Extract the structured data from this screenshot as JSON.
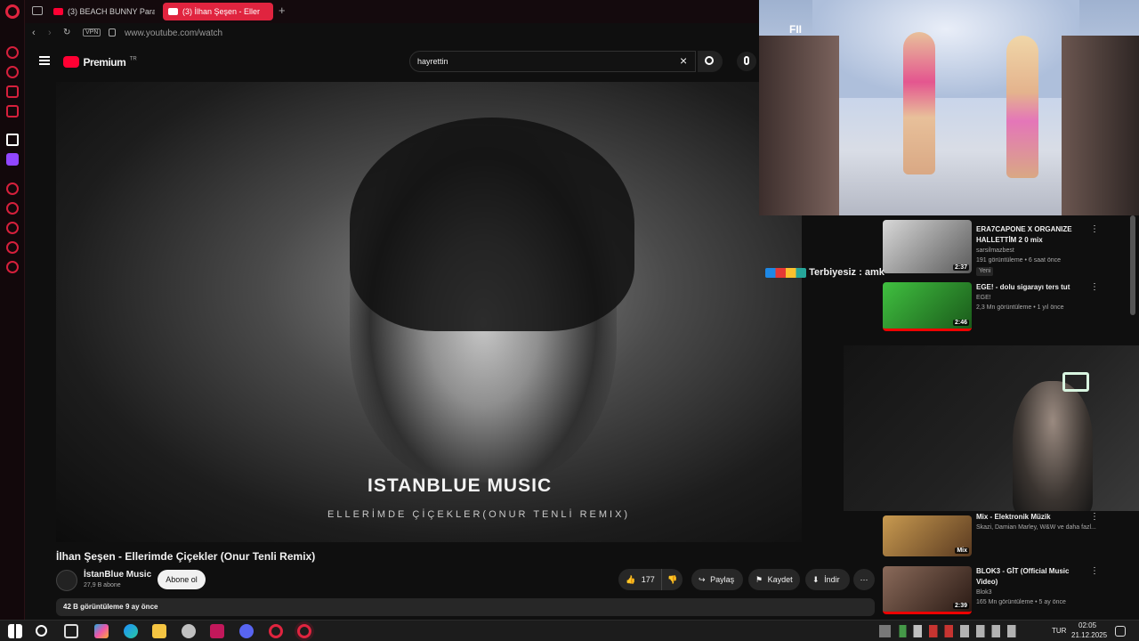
{
  "tabs": [
    {
      "label": "(3) BEACH BUNNY Paradi"
    },
    {
      "label": "(3) İlhan Şeşen - Eller"
    }
  ],
  "address": {
    "vpn": "VPN",
    "url": "www.youtube.com/watch"
  },
  "header": {
    "logo": "Premium",
    "logo_sup": "TR",
    "search_value": "hayrettin"
  },
  "video": {
    "overlay_title": "ISTANBLUE MUSIC",
    "overlay_sub": "ELLERİMDE ÇİÇEKLER(ONUR TENLİ REMIX)",
    "title": "İlhan Şeşen - Ellerimde Çiçekler (Onur Tenli Remix)"
  },
  "channel": {
    "name": "İstanBlue Music",
    "subs": "27,9 B abone",
    "subscribe": "Abone ol"
  },
  "actions": {
    "likes": "177",
    "share": "Paylaş",
    "save": "Kaydet",
    "download": "İndir"
  },
  "description": {
    "views": "42 B görüntüleme",
    "date": "9 ay önce"
  },
  "chat": {
    "text": "Terbiyesiz : amk"
  },
  "related": [
    {
      "title1": "ERA7CAPONE X ORGANIZE",
      "title2": "HALLETTİM 2 0 mix",
      "channel": "sarsilmazbest",
      "meta": "191 görüntüleme • 6 saat önce",
      "badge": "Yeni",
      "duration": "2:37"
    },
    {
      "title1": "EGE! - dolu sigarayı ters tut",
      "title2": "",
      "channel": "EGE!",
      "meta": "2,3 Mn görüntüleme • 1 yıl önce",
      "badge": "",
      "duration": "2:46"
    },
    {
      "title1": "Mix - Elektronik Müzik",
      "title2": "",
      "channel": "Skazi, Damian Marley, W&W ve daha fazl...",
      "meta": "",
      "badge": "",
      "duration": "Mix"
    },
    {
      "title1": "BLOK3 - GİT (Official Music",
      "title2": "Video)",
      "channel": "Blok3",
      "meta": "165 Mn görüntüleme • 5 ay önce",
      "badge": "",
      "duration": "2:39"
    }
  ],
  "pip": {
    "label": "FII"
  },
  "taskbar": {
    "lang": "TUR",
    "time": "02:05",
    "date": "21.12.2025"
  }
}
